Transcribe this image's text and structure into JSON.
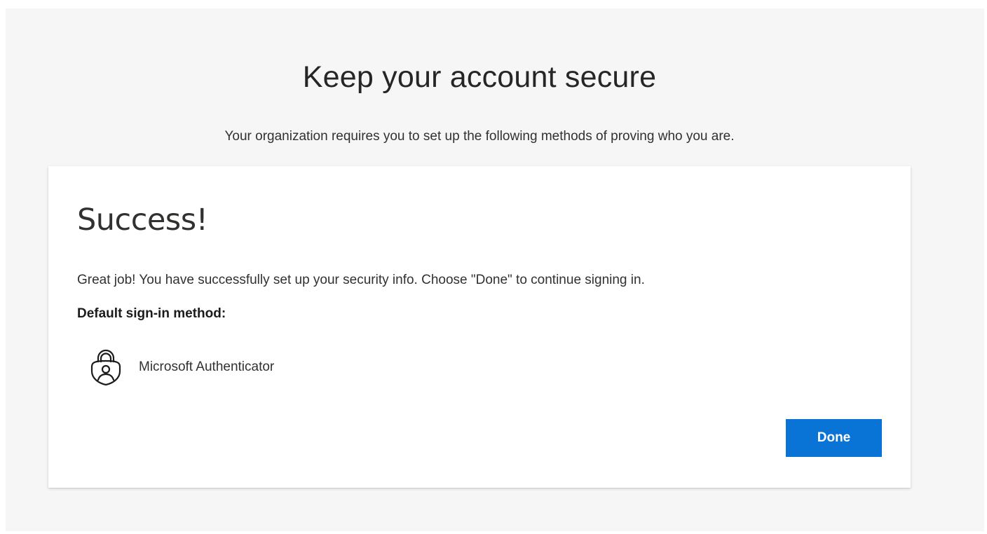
{
  "header": {
    "title": "Keep your account secure",
    "subtitle": "Your organization requires you to set up the following methods of proving who you are."
  },
  "card": {
    "heading": "Success!",
    "message": "Great job! You have successfully set up your security info. Choose \"Done\" to continue signing in.",
    "default_method_label": "Default sign-in method:",
    "method": {
      "icon": "authenticator-lock-icon",
      "name": "Microsoft Authenticator"
    },
    "done_label": "Done"
  },
  "colors": {
    "page_background": "#f6f6f6",
    "card_background": "#ffffff",
    "button_background": "#0a74d6",
    "button_text": "#ffffff"
  }
}
